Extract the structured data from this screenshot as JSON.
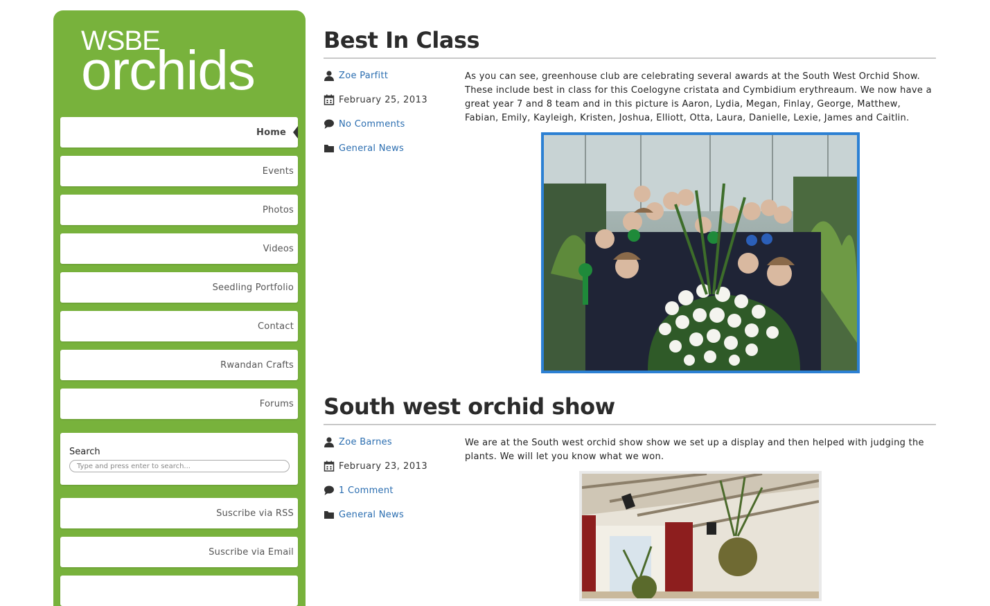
{
  "site": {
    "logo_top": "WSBE",
    "logo_main": "orchids"
  },
  "nav": [
    {
      "label": "Home",
      "active": true
    },
    {
      "label": "Events"
    },
    {
      "label": "Photos"
    },
    {
      "label": "Videos"
    },
    {
      "label": "Seedling Portfolio"
    },
    {
      "label": "Contact"
    },
    {
      "label": "Rwandan Crafts"
    },
    {
      "label": "Forums"
    }
  ],
  "search": {
    "label": "Search",
    "placeholder": "Type and press enter to search..."
  },
  "subscribe": {
    "rss": "Suscribe via RSS",
    "email": "Suscribe via Email"
  },
  "posts": [
    {
      "title": "Best In Class",
      "author": "Zoe Parfitt",
      "date": "February 25, 2013",
      "comments": "No Comments",
      "category": "General News",
      "body": "As you can see, greenhouse club are celebrating several awards at the South West Orchid Show. These include best in class for this Coelogyne cristata and Cymbidium erythreaum. We now have a great year 7 and 8 team and in this picture is Aaron, Lydia, Megan, Finlay, George, Matthew, Fabian, Emily, Kayleigh, Kristen, Joshua, Elliott, Otta, Laura, Danielle, Lexie, James and Caitlin."
    },
    {
      "title": "South west orchid show",
      "author": "Zoe Barnes",
      "date": "February 23, 2013",
      "comments": "1 Comment",
      "category": "General News",
      "body": "We are at the South west orchid show show we set up a display and then helped with judging the plants. We will let you know what we won."
    }
  ],
  "colors": {
    "sidebar": "#78b23c",
    "link": "#2a6db0",
    "photo_border": "#2c80d3"
  },
  "icons": {
    "author": "user-icon",
    "date": "calendar-icon",
    "comments": "speech-bubble-icon",
    "category": "folder-icon"
  }
}
